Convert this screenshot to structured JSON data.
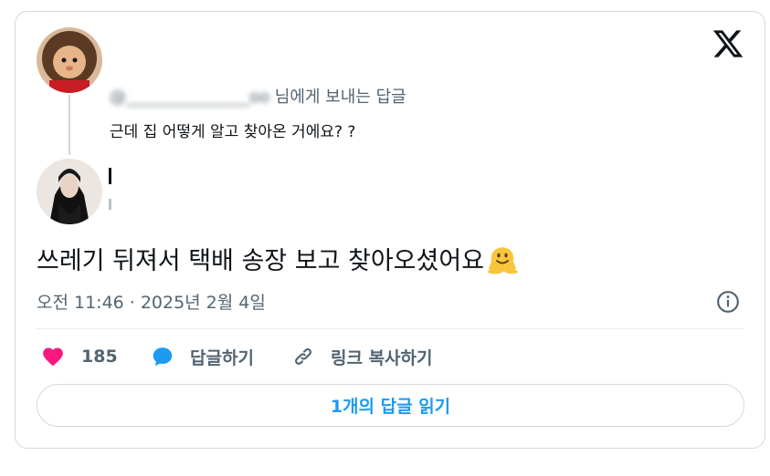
{
  "reply_context": {
    "handle": "@_______________oo",
    "suffix": "님에게 보내는 답글"
  },
  "quoted_tweet": {
    "text": "근데 집 어떻게 알고 찾아온 거에요? ?"
  },
  "main_tweet": {
    "text": "쓰레기 뒤져서 택배 송장 보고 찾아오셨어요"
  },
  "meta": {
    "time": "오전 11:46",
    "separator": "·",
    "date": "2025년 2월 4일"
  },
  "actions": {
    "like_count": "185",
    "reply_label": "답글하기",
    "copy_link_label": "링크 복사하기"
  },
  "read_replies_button": "1개의 답글 읽기",
  "colors": {
    "like": "#f91880",
    "reply": "#1d9bf0",
    "text": "#0f1419",
    "muted": "#536471",
    "border": "#cfd9de",
    "link": "#1d9bf0"
  },
  "icons": {
    "brand": "x-logo-icon",
    "like": "heart-icon",
    "reply": "speech-bubble-icon",
    "copy": "link-icon",
    "info": "info-icon",
    "emoji": "melting-face-emoji"
  }
}
